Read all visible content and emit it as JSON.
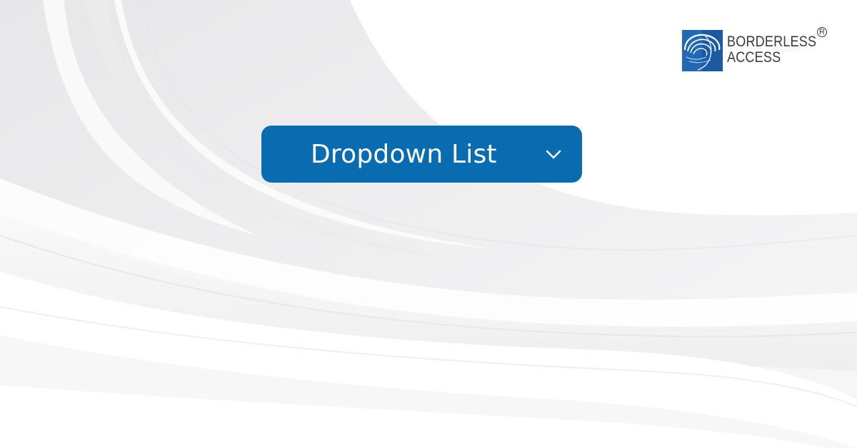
{
  "brand": {
    "name_line1": "BORDERLESS",
    "name_line2": "ACCESS",
    "registered_mark": "R",
    "logo_icon": "borderless-access-logo-icon",
    "brand_color": "#1f66b0"
  },
  "dropdown": {
    "label": "Dropdown List",
    "icon": "chevron-down-icon",
    "background_color": "#0a6cb0",
    "text_color": "#ffffff"
  },
  "background": {
    "color": "#f4f4f5"
  }
}
